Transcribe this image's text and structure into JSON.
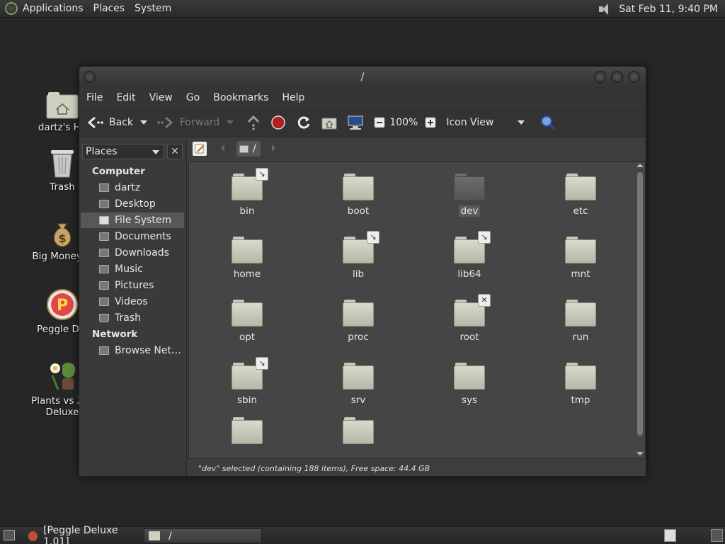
{
  "top_panel": {
    "menus": [
      "Applications",
      "Places",
      "System"
    ],
    "clock": "Sat Feb 11,  9:40 PM"
  },
  "desktop_icons": [
    {
      "label": "dartz's Ho",
      "icon": "home-folder-icon"
    },
    {
      "label": "Trash",
      "icon": "trash-icon"
    },
    {
      "label": "Big Money D",
      "icon": "money-bag-icon"
    },
    {
      "label": "Peggle Del",
      "icon": "peggle-icon"
    },
    {
      "label": "Plants vs Zor",
      "label2": "Deluxe",
      "icon": "plants-vs-zombies-icon"
    }
  ],
  "window": {
    "title": "/",
    "menu": [
      "File",
      "Edit",
      "View",
      "Go",
      "Bookmarks",
      "Help"
    ],
    "toolbar": {
      "back": "Back",
      "forward": "Forward",
      "zoom": "100%",
      "view_mode": "Icon View"
    },
    "path": "/",
    "sidebar": {
      "selector": "Places",
      "close": "✕",
      "computer_heading": "Computer",
      "items": [
        "dartz",
        "Desktop",
        "File System",
        "Documents",
        "Downloads",
        "Music",
        "Pictures",
        "Videos",
        "Trash"
      ],
      "network_heading": "Network",
      "network_items": [
        "Browse Net…"
      ]
    },
    "folders": [
      {
        "name": "bin",
        "emblem": "↘"
      },
      {
        "name": "boot",
        "emblem": ""
      },
      {
        "name": "dev",
        "emblem": ""
      },
      {
        "name": "etc",
        "emblem": ""
      },
      {
        "name": "home",
        "emblem": ""
      },
      {
        "name": "lib",
        "emblem": "↘"
      },
      {
        "name": "lib64",
        "emblem": "↘"
      },
      {
        "name": "mnt",
        "emblem": ""
      },
      {
        "name": "opt",
        "emblem": ""
      },
      {
        "name": "proc",
        "emblem": ""
      },
      {
        "name": "root",
        "emblem": "✕"
      },
      {
        "name": "run",
        "emblem": ""
      },
      {
        "name": "sbin",
        "emblem": "↘"
      },
      {
        "name": "srv",
        "emblem": ""
      },
      {
        "name": "sys",
        "emblem": ""
      },
      {
        "name": "tmp",
        "emblem": ""
      },
      {
        "name": "",
        "emblem": ""
      },
      {
        "name": "",
        "emblem": ""
      }
    ],
    "status": "\"dev\" selected (containing 188 items), Free space: 44.4 GB"
  },
  "bottom_panel": {
    "tasks": [
      "[Peggle Deluxe 1.01]",
      "/"
    ]
  }
}
